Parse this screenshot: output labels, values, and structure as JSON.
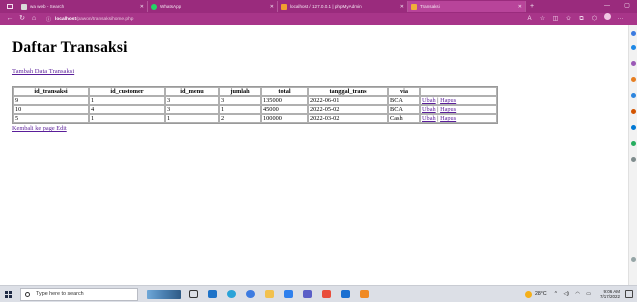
{
  "browser": {
    "tabs": [
      {
        "title": "wa web - Search",
        "favicon_color": "#d9d9d9",
        "active": false
      },
      {
        "title": "WhatsApp",
        "favicon_color": "#25d366",
        "active": false
      },
      {
        "title": "localhost / 127.0.0.1 | phpMyAdmin",
        "favicon_color": "#f0a030",
        "active": false
      },
      {
        "title": "Transaksi",
        "favicon_color": "#f0b03a",
        "active": true
      }
    ],
    "url": {
      "host": "localhost",
      "path": "/pawon/transaksihome.php"
    },
    "accent_color": "#a83589"
  },
  "page": {
    "title": "Daftar Transaksi",
    "add_link": "Tambah Data Transaksi",
    "back_link": "Kembali ke page Edit",
    "table": {
      "headers": [
        "id_transaksi",
        "id_customer",
        "id_menu",
        "jumlah",
        "total",
        "tanggal_trans",
        "via",
        ""
      ],
      "rows": [
        {
          "id_transaksi": "9",
          "id_customer": "1",
          "id_menu": "3",
          "jumlah": "3",
          "total": "135000",
          "tanggal_trans": "2022-06-01",
          "via": "BCA",
          "edit": "Ubah",
          "sep": "|",
          "delete": "Hapus"
        },
        {
          "id_transaksi": "10",
          "id_customer": "4",
          "id_menu": "3",
          "jumlah": "1",
          "total": "45000",
          "tanggal_trans": "2022-05-02",
          "via": "BCA",
          "edit": "Ubah",
          "sep": "|",
          "delete": "Hapus"
        },
        {
          "id_transaksi": "5",
          "id_customer": "1",
          "id_menu": "1",
          "jumlah": "2",
          "total": "100000",
          "tanggal_trans": "2022-03-02",
          "via": "Cash",
          "edit": "Ubah",
          "sep": "|",
          "delete": "Hapus"
        }
      ]
    }
  },
  "taskbar": {
    "search_placeholder": "Type here to search",
    "weather": "28°C",
    "time": "9:06 AM",
    "date": "7/17/2022"
  }
}
